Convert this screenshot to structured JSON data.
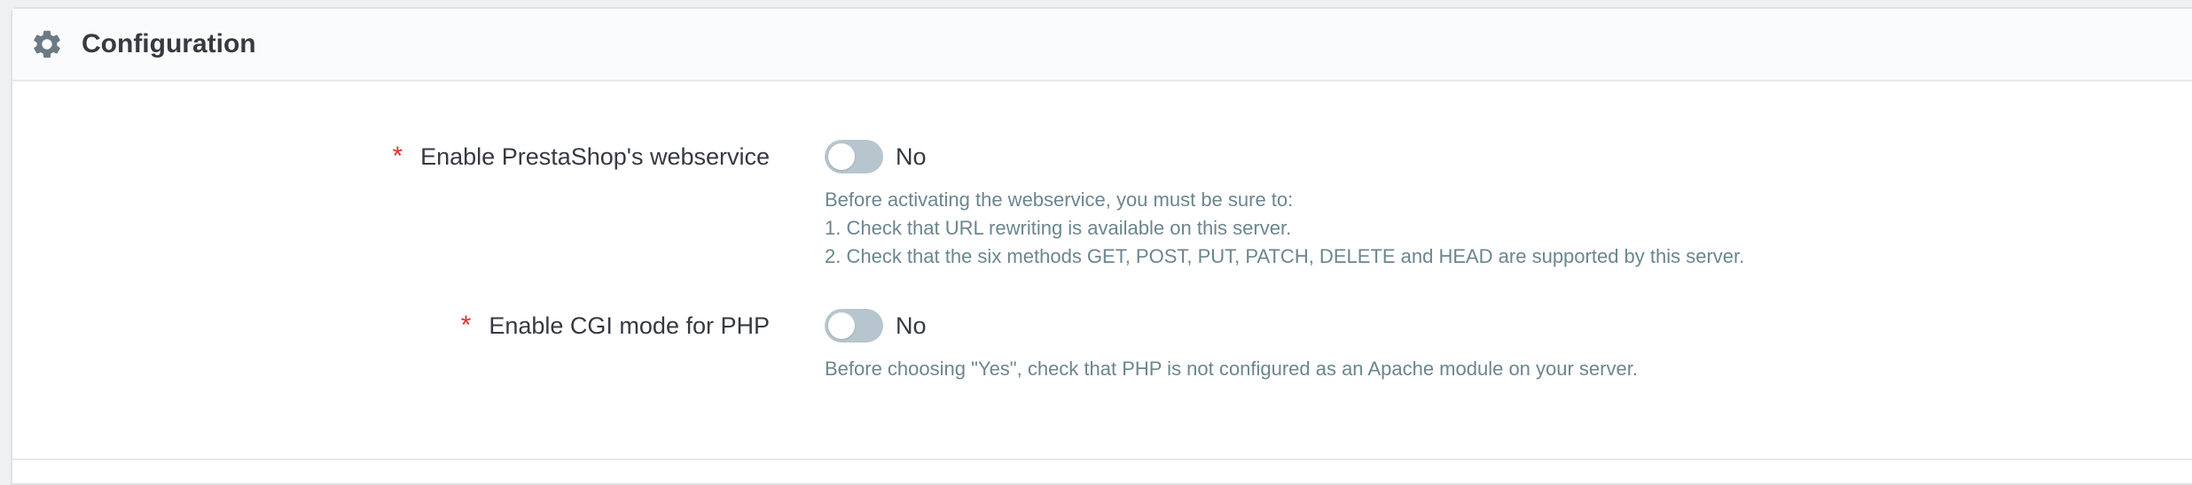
{
  "panel": {
    "title": "Configuration",
    "icon": "gear-icon"
  },
  "fields": [
    {
      "label": "Enable PrestaShop's webservice",
      "required_mark": "*",
      "toggle_value": "No",
      "enabled": false,
      "help_lines": [
        "Before activating the webservice, you must be sure to:",
        "1. Check that URL rewriting is available on this server.",
        "2. Check that the six methods GET, POST, PUT, PATCH, DELETE and HEAD are supported by this server."
      ]
    },
    {
      "label": "Enable CGI mode for PHP",
      "required_mark": "*",
      "toggle_value": "No",
      "enabled": false,
      "help_lines": [
        "Before choosing \"Yes\", check that PHP is not configured as an Apache module on your server."
      ]
    }
  ],
  "colors": {
    "required": "#e02f2f",
    "toggle_off": "#b7c6ce",
    "help_text": "#6c868e",
    "label_text": "#363a41"
  }
}
